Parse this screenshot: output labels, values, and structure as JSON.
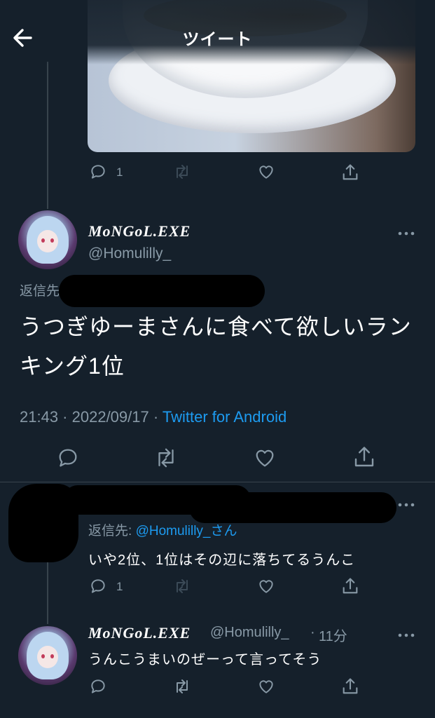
{
  "header": {
    "title": "ツイート",
    "back_icon": "arrow-left-icon"
  },
  "prev_tweet": {
    "photo_alt_icon": "photo-thumbnail",
    "reply_count": "1",
    "actions": [
      "reply-icon",
      "retweet-icon",
      "like-icon",
      "share-icon"
    ]
  },
  "main_tweet": {
    "display_name": "MoNGoL.EXE",
    "handle": "@Homulilly_",
    "reply_to_label": "返信先",
    "text": "うつぎゆーまさんに食べて欲しいランキング1位",
    "time": "21:43",
    "date": "2022/09/17",
    "separator": " · ",
    "source": "Twitter for Android",
    "actions": [
      "reply-icon",
      "retweet-icon",
      "like-icon",
      "share-icon"
    ]
  },
  "reply_1": {
    "reply_to_label": "返信先: ",
    "reply_to_handle": "@Homulilly_さん",
    "text": "いや2位、1位はその辺に落ちてるうんこ",
    "reply_count": "1"
  },
  "reply_2": {
    "display_name": "MoNGoL.EXE",
    "handle": "@Homulilly_",
    "time_ago": "11分",
    "dot": "·",
    "text": "うんこうまいのぜーって言ってそう"
  },
  "colors": {
    "background": "#15202b",
    "accent": "#1d9bf0",
    "muted": "#8899a6",
    "divider": "#38444d"
  }
}
